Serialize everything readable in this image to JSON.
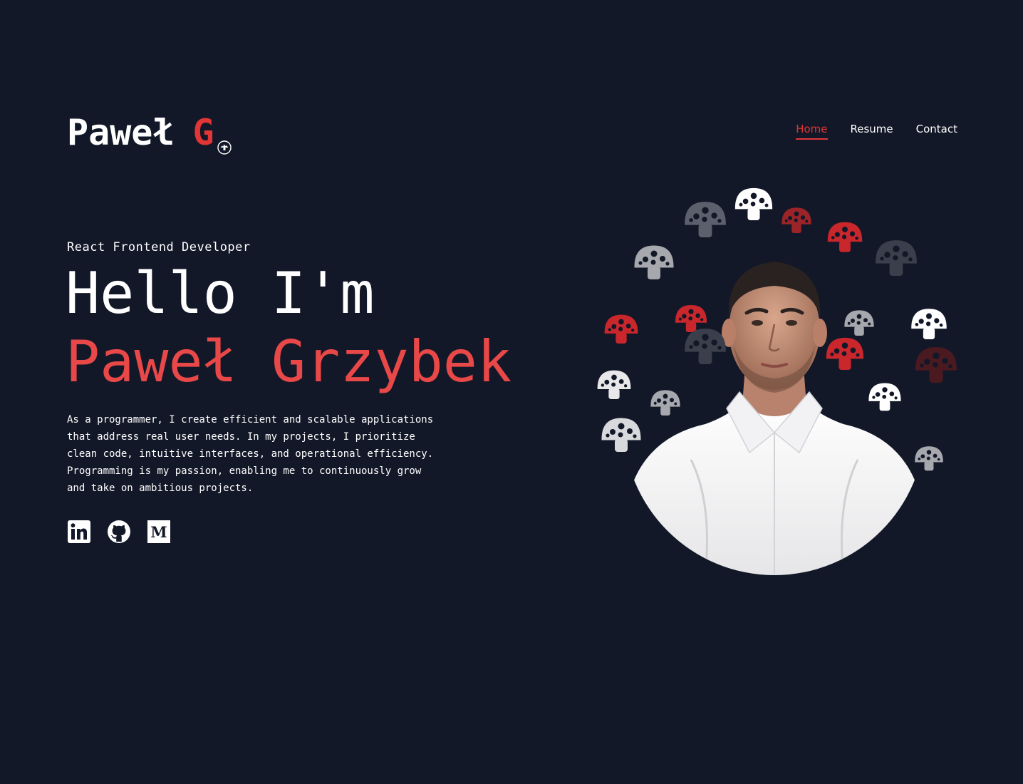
{
  "header": {
    "logo_first": "Paweł",
    "logo_initial": "G",
    "nav": [
      {
        "label": "Home",
        "active": true
      },
      {
        "label": "Resume",
        "active": false
      },
      {
        "label": "Contact",
        "active": false
      }
    ]
  },
  "hero": {
    "role": "React Frontend Developer",
    "greeting": "Hello I'm",
    "name": "Paweł Grzybek",
    "bio": "As a programmer, I create efficient and scalable applications that address real user needs. In my projects, I prioritize clean code, intuitive interfaces, and operational efficiency. Programming is my passion, enabling me to continuously grow and take on ambitious projects."
  },
  "socials": [
    {
      "icon": "linkedin-icon"
    },
    {
      "icon": "github-icon"
    },
    {
      "icon": "medium-icon",
      "glyph": "M"
    }
  ],
  "colors": {
    "background": "#131828",
    "accent": "#e23535",
    "text": "#ffffff"
  }
}
